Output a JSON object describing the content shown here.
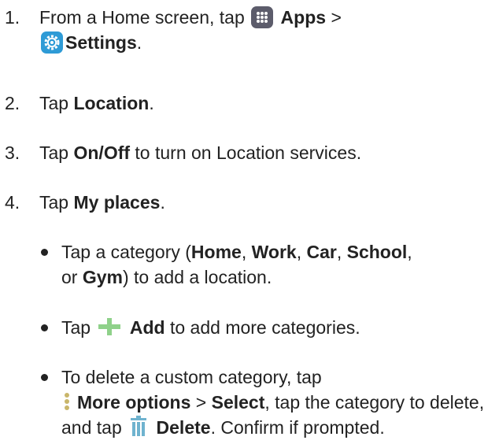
{
  "steps": [
    {
      "number": "1.",
      "t1": "From a Home screen, tap",
      "apps_label": "Apps",
      "t2": ">",
      "settings_label": "Settings",
      "t3": "."
    },
    {
      "number": "2.",
      "t1": "Tap",
      "b1": "Location",
      "t2": "."
    },
    {
      "number": "3.",
      "t1": "Tap",
      "b1": "On/Off",
      "t2": "to turn on Location services."
    },
    {
      "number": "4.",
      "t1": "Tap",
      "b1": "My places",
      "t2": "."
    }
  ],
  "bullets": [
    {
      "t1": "Tap a category (",
      "home": "Home",
      "c1": ",",
      "work": "Work",
      "c2": ",",
      "car": "Car",
      "c3": ",",
      "school": "School",
      "c4": ",",
      "t2": "or",
      "gym": "Gym",
      "t3": ") to add a location."
    },
    {
      "t1": "Tap",
      "add_label": "Add",
      "t2": "to add more categories."
    },
    {
      "t1": "To delete a custom category, tap",
      "more_label": "More options",
      "t2": ">",
      "select_label": "Select",
      "t3": ", tap the category to delete, and tap",
      "delete_label": "Delete",
      "t4": ". Confirm if prompted."
    }
  ],
  "icons": {
    "apps": "apps-grid-icon",
    "settings": "settings-gear-icon",
    "add": "plus-icon",
    "more": "more-options-icon",
    "delete": "trash-icon"
  },
  "colors": {
    "text": "#222222",
    "apps_icon_bg": "#5c5c6b",
    "settings_icon_bg": "#2e9bd6",
    "plus_icon": "#8fd18a",
    "more_icon": "#c9b66a",
    "trash_icon": "#6fb3cf"
  }
}
